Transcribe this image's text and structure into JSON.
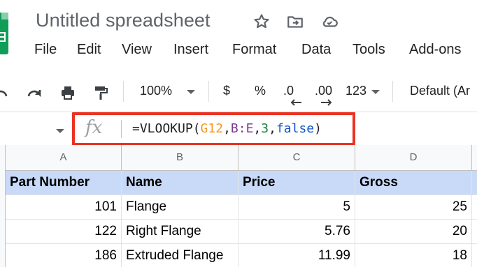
{
  "header": {
    "title": "Untitled spreadsheet"
  },
  "menu": {
    "file": "File",
    "edit": "Edit",
    "view": "View",
    "insert": "Insert",
    "format": "Format",
    "data": "Data",
    "tools": "Tools",
    "addons": "Add-ons"
  },
  "toolbar": {
    "zoom": "100%",
    "currency": "$",
    "percent": "%",
    "decrease_decimals": ".0",
    "increase_decimals": ".00",
    "more_formats": "123",
    "font": "Default (Ar"
  },
  "formula_bar": {
    "parts": {
      "prefix": "=VLOOKUP(",
      "arg1": "G12",
      "comma1": ",",
      "arg2": "B:E",
      "comma2": ",",
      "arg3": "3",
      "comma3": ",",
      "arg4": "false",
      "suffix": ")"
    },
    "colors": {
      "ref1": "#f7981d",
      "ref2": "#7e3794",
      "number": "#188038",
      "boolean": "#1155cc"
    },
    "highlight_color": "#ea3323"
  },
  "sheet": {
    "columns": [
      "A",
      "B",
      "C",
      "D"
    ],
    "header_row": [
      "Part Number",
      "Name",
      "Price",
      "Gross"
    ],
    "rows": [
      [
        "101",
        "Flange",
        "5",
        "25"
      ],
      [
        "122",
        "Right Flange",
        "5.76",
        "20"
      ],
      [
        "186",
        "Extruded Flange",
        "11.99",
        "18"
      ]
    ],
    "header_fill": "#c9daf8"
  }
}
